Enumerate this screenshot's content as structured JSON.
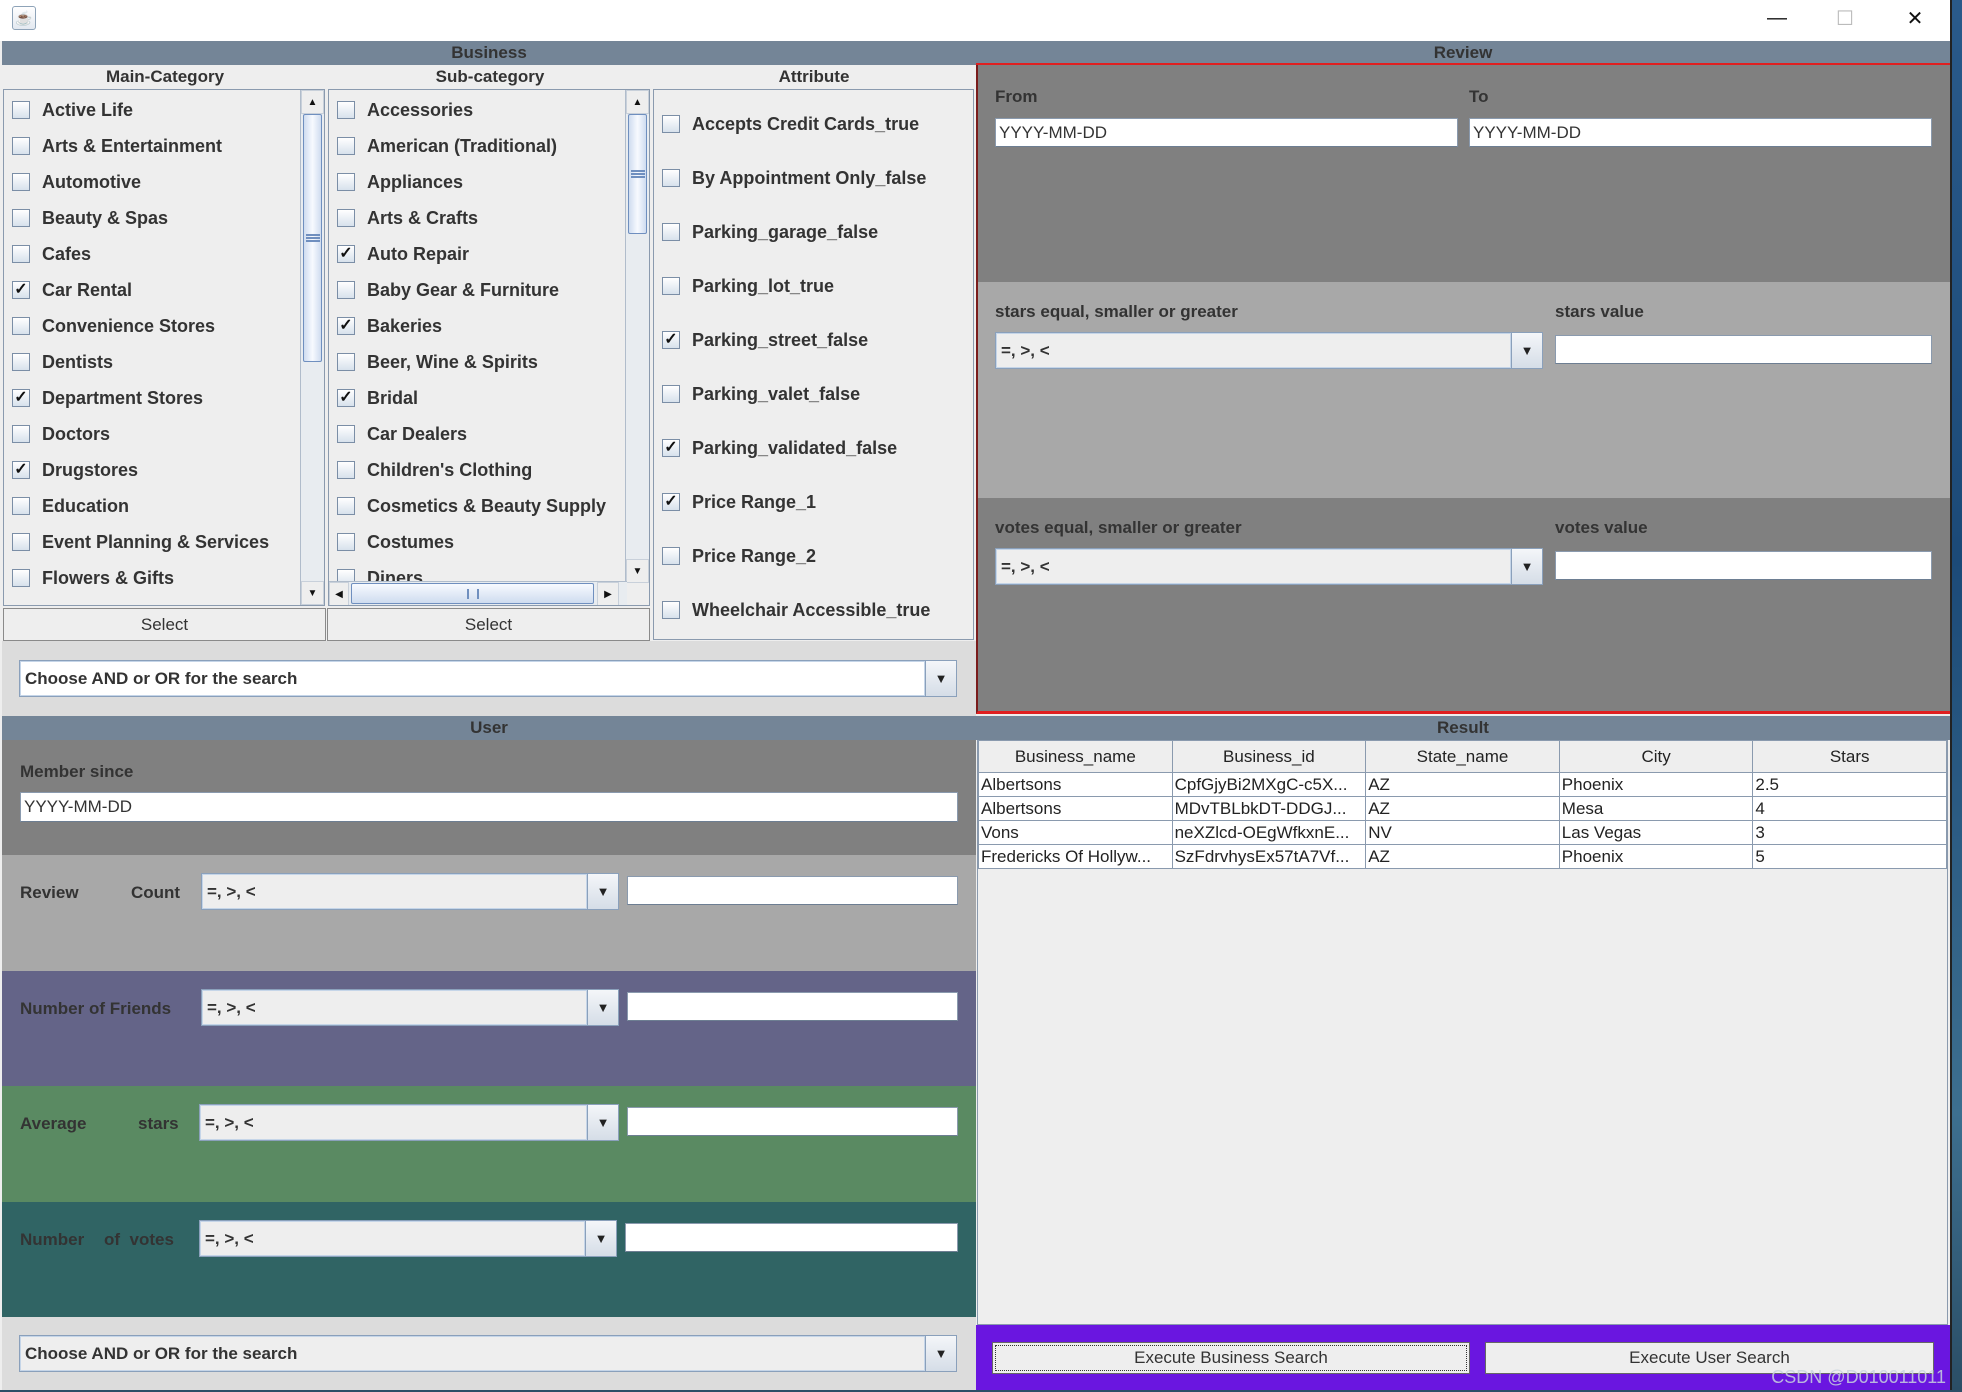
{
  "window": {
    "icon": "java-coffee-icon",
    "controls": {
      "minimize": "—",
      "maximize": "☐",
      "close": "✕"
    }
  },
  "business": {
    "title": "Business",
    "main_category": {
      "header": "Main-Category",
      "items": [
        {
          "label": "Active Life",
          "checked": false
        },
        {
          "label": "Arts & Entertainment",
          "checked": false
        },
        {
          "label": "Automotive",
          "checked": false
        },
        {
          "label": "Beauty & Spas",
          "checked": false
        },
        {
          "label": "Cafes",
          "checked": false
        },
        {
          "label": "Car Rental",
          "checked": true
        },
        {
          "label": "Convenience Stores",
          "checked": false
        },
        {
          "label": "Dentists",
          "checked": false
        },
        {
          "label": "Department Stores",
          "checked": true
        },
        {
          "label": "Doctors",
          "checked": false
        },
        {
          "label": "Drugstores",
          "checked": true
        },
        {
          "label": "Education",
          "checked": false
        },
        {
          "label": "Event Planning & Services",
          "checked": false
        },
        {
          "label": "Flowers & Gifts",
          "checked": false
        }
      ],
      "select_label": "Select"
    },
    "sub_category": {
      "header": "Sub-category",
      "items": [
        {
          "label": "Accessories",
          "checked": false
        },
        {
          "label": "American (Traditional)",
          "checked": false
        },
        {
          "label": "Appliances",
          "checked": false
        },
        {
          "label": "Arts & Crafts",
          "checked": false
        },
        {
          "label": "Auto Repair",
          "checked": true
        },
        {
          "label": "Baby Gear & Furniture",
          "checked": false
        },
        {
          "label": "Bakeries",
          "checked": true
        },
        {
          "label": "Beer, Wine & Spirits",
          "checked": false
        },
        {
          "label": "Bridal",
          "checked": true
        },
        {
          "label": "Car Dealers",
          "checked": false
        },
        {
          "label": "Children's Clothing",
          "checked": false
        },
        {
          "label": "Cosmetics & Beauty Supply",
          "checked": false
        },
        {
          "label": "Costumes",
          "checked": false
        },
        {
          "label": "Diners",
          "checked": false
        }
      ],
      "select_label": "Select"
    },
    "attribute": {
      "header": "Attribute",
      "items": [
        {
          "label": "Accepts Credit Cards_true",
          "checked": false
        },
        {
          "label": "By Appointment Only_false",
          "checked": false
        },
        {
          "label": "Parking_garage_false",
          "checked": false
        },
        {
          "label": "Parking_lot_true",
          "checked": false
        },
        {
          "label": "Parking_street_false",
          "checked": true
        },
        {
          "label": "Parking_valet_false",
          "checked": false
        },
        {
          "label": "Parking_validated_false",
          "checked": true
        },
        {
          "label": "Price Range_1",
          "checked": true
        },
        {
          "label": "Price Range_2",
          "checked": false
        },
        {
          "label": "Wheelchair Accessible_true",
          "checked": false
        }
      ]
    },
    "and_or": {
      "value": "Choose AND or OR for the search"
    }
  },
  "review": {
    "title": "Review",
    "from_label": "From",
    "from_value": "YYYY-MM-DD",
    "to_label": "To",
    "to_value": "YYYY-MM-DD",
    "stars_op_label": "stars equal, smaller or greater",
    "stars_op_value": "=, >, <",
    "stars_value_label": "stars value",
    "stars_value": "",
    "votes_op_label": "votes equal, smaller or greater",
    "votes_op_value": "=, >, <",
    "votes_value_label": "votes value",
    "votes_value": ""
  },
  "user": {
    "title": "User",
    "member_since_label": "Member since",
    "member_since_value": "YYYY-MM-DD",
    "filters": [
      {
        "label_a": "Review",
        "label_b": "Count",
        "op": "=, >, <",
        "value": ""
      },
      {
        "label_a": "Number of Friends",
        "label_b": "",
        "op": "=, >, <",
        "value": ""
      },
      {
        "label_a": "Average",
        "label_b": "stars",
        "op": "=, >, <",
        "value": ""
      },
      {
        "label_a": "Number",
        "label_b": "of  votes",
        "op": "=, >, <",
        "value": ""
      }
    ],
    "and_or": {
      "value": "Choose AND or OR for the search"
    }
  },
  "result": {
    "title": "Result",
    "columns": [
      "Business_name",
      "Business_id",
      "State_name",
      "City",
      "Stars"
    ],
    "rows": [
      [
        "Albertsons",
        "CpfGjyBi2MXgC-c5X...",
        "AZ",
        "Phoenix",
        "2.5"
      ],
      [
        "Albertsons",
        "MDvTBLbkDT-DDGJ...",
        "AZ",
        "Mesa",
        "4"
      ],
      [
        "Vons",
        "neXZlcd-OEgWfkxnE...",
        "NV",
        "Las Vegas",
        "3"
      ],
      [
        "Fredericks Of Hollyw...",
        "SzFdrvhysEx57tA7Vf...",
        "AZ",
        "Phoenix",
        "5"
      ]
    ]
  },
  "actions": {
    "execute_business": "Execute Business Search",
    "execute_user": "Execute User Search"
  },
  "watermark": "CSDN @D010011011",
  "colors": {
    "section_header": "#748597",
    "review_dark": "#808080",
    "review_light": "#a8a8a8",
    "friends_bg": "#646488",
    "average_bg": "#5a8a62",
    "votes_bg": "#306464",
    "action_bar": "#6a16e0",
    "divider_red": "#e02020"
  }
}
